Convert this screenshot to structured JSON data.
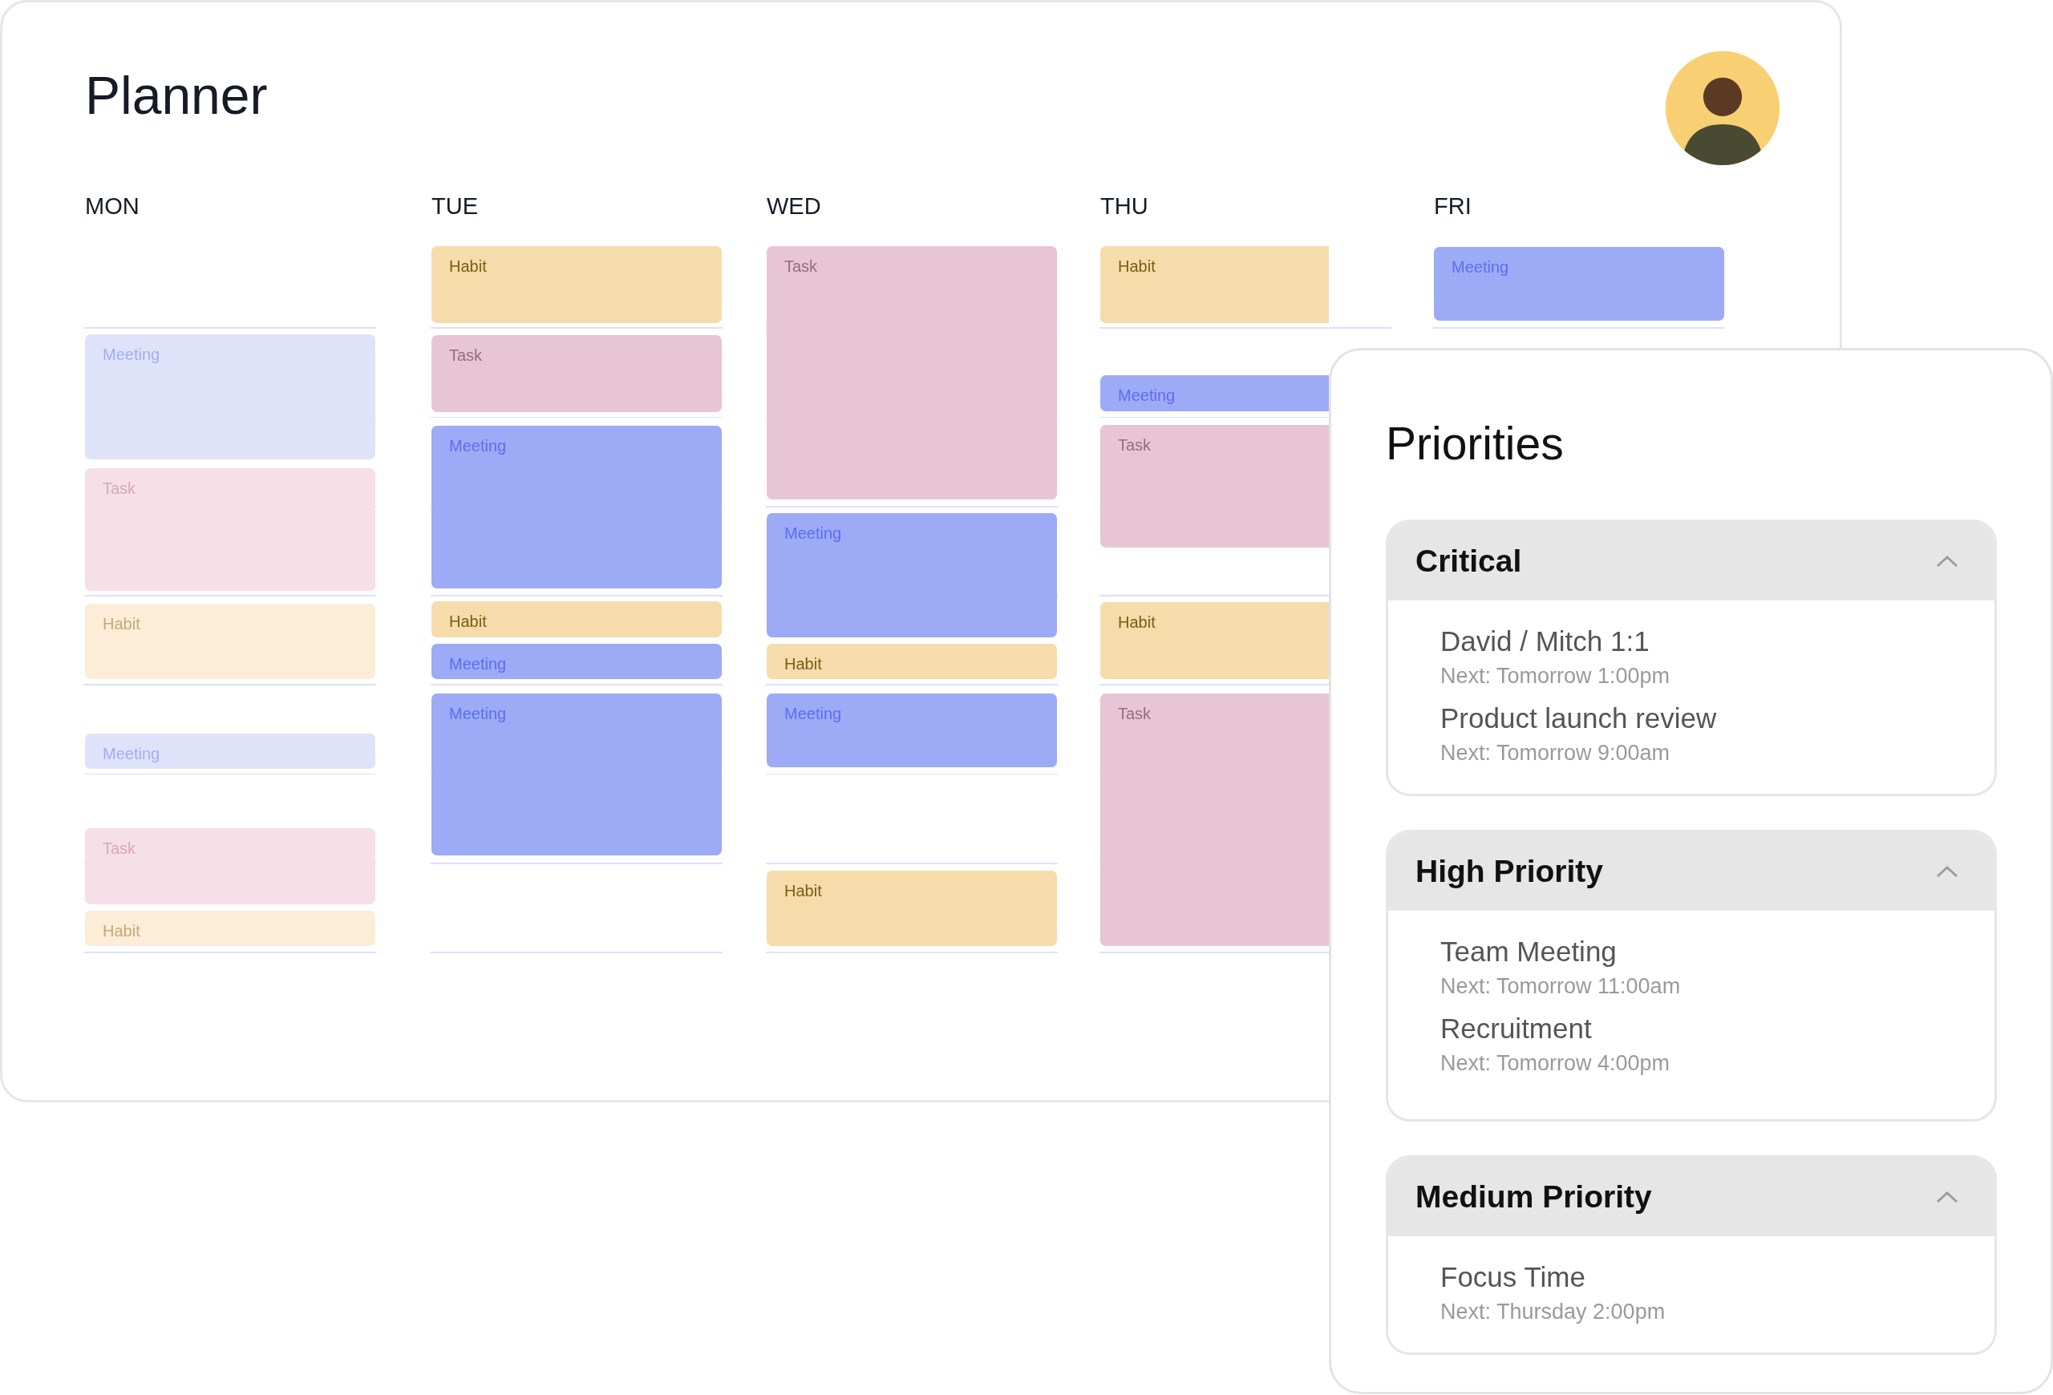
{
  "planner": {
    "title": "Planner",
    "days": [
      {
        "label": "MON",
        "dimmed": true,
        "events": [
          {
            "kind": "meeting",
            "label": "Meeting"
          },
          {
            "kind": "task",
            "label": "Task"
          },
          {
            "kind": "habit",
            "label": "Habit"
          },
          {
            "kind": "meeting",
            "label": "Meeting"
          },
          {
            "kind": "task",
            "label": "Task"
          },
          {
            "kind": "habit",
            "label": "Habit"
          }
        ]
      },
      {
        "label": "TUE",
        "dimmed": false,
        "events": [
          {
            "kind": "habit",
            "label": "Habit"
          },
          {
            "kind": "task",
            "label": "Task"
          },
          {
            "kind": "meeting",
            "label": "Meeting"
          },
          {
            "kind": "habit",
            "label": "Habit"
          },
          {
            "kind": "meeting",
            "label": "Meeting"
          },
          {
            "kind": "meeting",
            "label": "Meeting"
          }
        ]
      },
      {
        "label": "WED",
        "dimmed": false,
        "events": [
          {
            "kind": "task",
            "label": "Task"
          },
          {
            "kind": "meeting",
            "label": "Meeting"
          },
          {
            "kind": "habit",
            "label": "Habit"
          },
          {
            "kind": "meeting",
            "label": "Meeting"
          },
          {
            "kind": "habit",
            "label": "Habit"
          }
        ]
      },
      {
        "label": "THU",
        "dimmed": false,
        "events": [
          {
            "kind": "habit",
            "label": "Habit"
          },
          {
            "kind": "meeting",
            "label": "Meeting"
          },
          {
            "kind": "task",
            "label": "Task"
          },
          {
            "kind": "habit",
            "label": "Habit"
          },
          {
            "kind": "task",
            "label": "Task"
          }
        ]
      },
      {
        "label": "FRI",
        "dimmed": false,
        "events": [
          {
            "kind": "meeting",
            "label": "Meeting"
          }
        ]
      }
    ]
  },
  "priorities": {
    "title": "Priorities",
    "groups": [
      {
        "title": "Critical",
        "expanded": true,
        "items": [
          {
            "title": "David / Mitch 1:1",
            "next": "Next: Tomorrow 1:00pm"
          },
          {
            "title": "Product launch review",
            "next": "Next: Tomorrow 9:00am"
          }
        ]
      },
      {
        "title": "High Priority",
        "expanded": true,
        "items": [
          {
            "title": "Team Meeting",
            "next": "Next: Tomorrow 11:00am"
          },
          {
            "title": "Recruitment",
            "next": "Next: Tomorrow 4:00pm"
          }
        ]
      },
      {
        "title": "Medium Priority",
        "expanded": true,
        "items": [
          {
            "title": "Focus Time",
            "next": "Next: Thursday 2:00pm"
          }
        ]
      }
    ]
  }
}
